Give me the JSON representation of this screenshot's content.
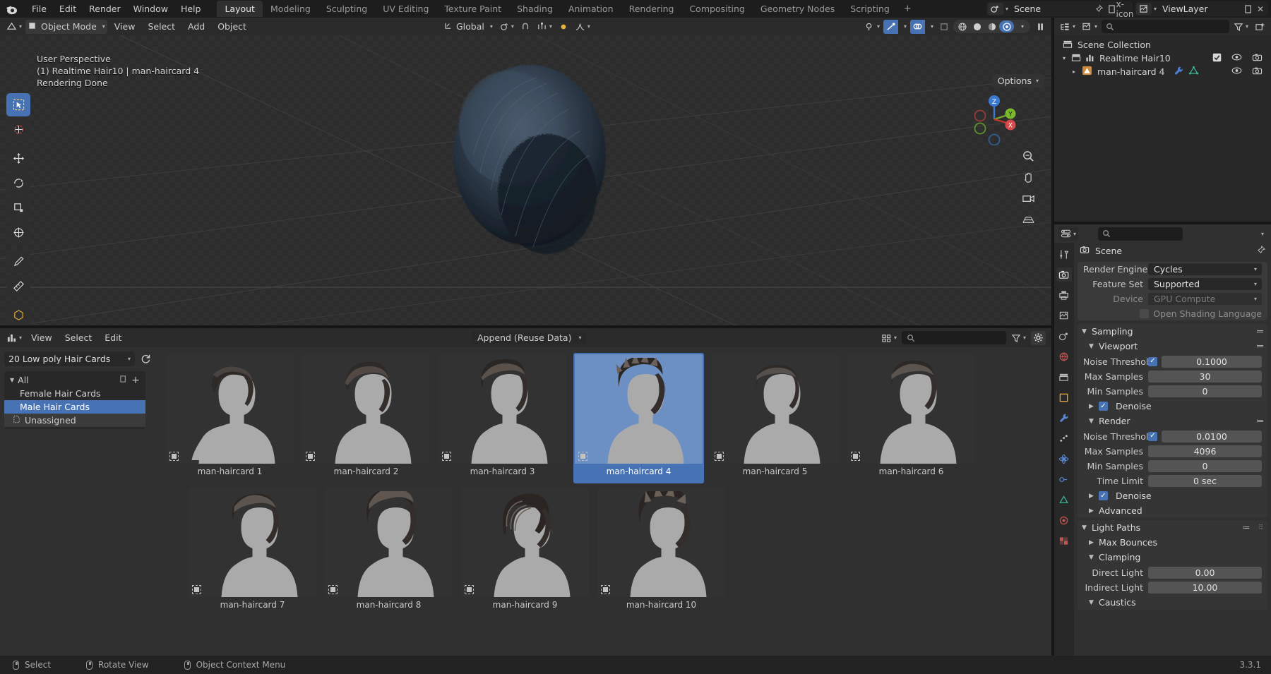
{
  "topbar": {
    "logo_icon": "blender-logo-icon",
    "menus": [
      "File",
      "Edit",
      "Render",
      "Window",
      "Help"
    ],
    "workspaces": [
      "Layout",
      "Modeling",
      "Sculpting",
      "UV Editing",
      "Texture Paint",
      "Shading",
      "Animation",
      "Rendering",
      "Compositing",
      "Geometry Nodes",
      "Scripting"
    ],
    "active_workspace": "Layout",
    "add_workspace_label": "+",
    "scene_name": "Scene",
    "viewlayer_name": "ViewLayer",
    "scene_icon": "scene-icon",
    "viewlayer_icon": "viewlayer-icon",
    "pin_icon": "pin-icon",
    "copy_icon": "new-copy-icon",
    "close_icon": "x-icon"
  },
  "viewport_header": {
    "editor_type_icon": "editor-type-icon",
    "mode": "Object Mode",
    "mode_icon": "object-mode-icon",
    "menus": [
      "View",
      "Select",
      "Add",
      "Object"
    ],
    "transform_orientation": "Global",
    "snap_icon": "magnet-icon",
    "proportional_icon": "proportional-edit-icon",
    "falloff_icon": "falloff-curve-icon",
    "visibility_icon": "visibility-icon",
    "gizmo_icon": "gizmo-icon",
    "overlays_icon": "overlays-icon",
    "xray_icon": "xray-icon",
    "shading_modes": [
      "wireframe",
      "solid",
      "material-preview",
      "rendered"
    ],
    "active_shading": "rendered",
    "pause_icon": "pause-render-icon"
  },
  "viewport": {
    "overlay_lines": [
      "User Perspective",
      "(1) Realtime Hair10 | man-haircard 4",
      "Rendering Done"
    ],
    "options_label": "Options",
    "gizmo_axes": [
      "Z",
      "Y",
      "X"
    ],
    "tools": [
      "select-box-tool",
      "cursor-tool",
      "move-tool",
      "rotate-tool",
      "scale-tool",
      "transform-tool",
      "annotate-tool",
      "measure-tool",
      "add-cube-tool"
    ],
    "active_tool": "select-box-tool",
    "nav_buttons": [
      "zoom-icon",
      "pan-hand-icon",
      "camera-view-icon",
      "ortho-persp-icon"
    ]
  },
  "outliner": {
    "display_mode_icon": "outliner-display-mode-icon",
    "filter_icon": "filter-icon",
    "new_collection_icon": "new-collection-icon",
    "search_placeholder": "",
    "rows": [
      {
        "label": "Scene Collection",
        "icon": "collection-icon",
        "indent": 0,
        "expander": "",
        "checkbox": false,
        "eye": false,
        "camera": false
      },
      {
        "label": "Realtime Hair10",
        "icon": "collection-icon",
        "indent": 1,
        "expander": "▾",
        "checkbox": true,
        "eye": true,
        "camera": true
      },
      {
        "label": "man-haircard 4",
        "icon": "mesh-object-icon",
        "indent": 2,
        "expander": "▸",
        "checkbox": false,
        "eye": true,
        "camera": true,
        "extra_icons": [
          "modifier-wrench-icon",
          "mesh-data-icon"
        ]
      }
    ]
  },
  "asset_browser": {
    "editor_type_icon": "asset-browser-icon",
    "menus": [
      "View",
      "Select",
      "Edit"
    ],
    "import_method": "Append (Reuse Data)",
    "library": "20 Low poly Hair Cards",
    "refresh_icon": "refresh-icon",
    "display_mode_icon": "thumbnail-grid-icon",
    "search_placeholder": "",
    "filter_icon": "filter-icon",
    "settings_icon": "gear-icon",
    "catalog_root": "All",
    "catalogs": [
      {
        "label": "Female Hair Cards",
        "selected": false,
        "unassigned": false
      },
      {
        "label": "Male Hair Cards",
        "selected": true,
        "unassigned": false
      },
      {
        "label": "Unassigned",
        "selected": false,
        "unassigned": true
      }
    ],
    "catalog_add_icon": "new-catalog-icon",
    "assets": [
      {
        "label": "man-haircard 1",
        "selected": false,
        "hair": "swept-right"
      },
      {
        "label": "man-haircard 2",
        "selected": false,
        "hair": "swept-left"
      },
      {
        "label": "man-haircard 3",
        "selected": false,
        "hair": "pompadour"
      },
      {
        "label": "man-haircard 4",
        "selected": true,
        "hair": "spiky"
      },
      {
        "label": "man-haircard 5",
        "selected": false,
        "hair": "short-flat"
      },
      {
        "label": "man-haircard 6",
        "selected": false,
        "hair": "side-part"
      },
      {
        "label": "man-haircard 7",
        "selected": false,
        "hair": "quiff"
      },
      {
        "label": "man-haircard 8",
        "selected": false,
        "hair": "tall-quiff"
      },
      {
        "label": "man-haircard 9",
        "selected": false,
        "hair": "long-fringe"
      },
      {
        "label": "man-haircard 10",
        "selected": false,
        "hair": "messy-tall"
      }
    ]
  },
  "properties": {
    "editor_type_icon": "properties-editor-icon",
    "search_placeholder": "",
    "breadcrumb": "Scene",
    "breadcrumb_icon": "render-properties-icon",
    "pin_icon": "pin-icon",
    "tabs": [
      "tool-icon",
      "render-properties-icon",
      "output-properties-icon",
      "view-layer-properties-icon",
      "scene-properties-icon",
      "world-properties-icon",
      "collection-properties-icon",
      "object-properties-icon",
      "modifier-properties-icon",
      "particles-properties-icon",
      "physics-properties-icon",
      "constraints-properties-icon",
      "data-properties-icon",
      "material-properties-icon",
      "texture-properties-icon"
    ],
    "active_tab_index": 1,
    "render_engine_label": "Render Engine",
    "render_engine_value": "Cycles",
    "feature_set_label": "Feature Set",
    "feature_set_value": "Supported",
    "device_label": "Device",
    "device_value": "GPU Compute",
    "osl_label": "Open Shading Language",
    "osl_checked": false,
    "panels": {
      "sampling": "Sampling",
      "viewport": "Viewport",
      "render": "Render",
      "advanced": "Advanced",
      "light_paths": "Light Paths",
      "max_bounces": "Max Bounces",
      "clamping": "Clamping",
      "caustics": "Caustics"
    },
    "viewport_sampling": {
      "noise_threshold_label": "Noise Threshold",
      "noise_threshold_checked": true,
      "noise_threshold_value": "0.1000",
      "max_samples_label": "Max Samples",
      "max_samples_value": "30",
      "min_samples_label": "Min Samples",
      "min_samples_value": "0",
      "denoise_label": "Denoise",
      "denoise_checked": true
    },
    "render_sampling": {
      "noise_threshold_label": "Noise Threshold",
      "noise_threshold_checked": true,
      "noise_threshold_value": "0.0100",
      "max_samples_label": "Max Samples",
      "max_samples_value": "4096",
      "min_samples_label": "Min Samples",
      "min_samples_value": "0",
      "time_limit_label": "Time Limit",
      "time_limit_value": "0 sec",
      "denoise_label": "Denoise",
      "denoise_checked": true
    },
    "clamping": {
      "direct_label": "Direct Light",
      "direct_value": "0.00",
      "indirect_label": "Indirect Light",
      "indirect_value": "10.00"
    }
  },
  "statusbar": {
    "items": [
      {
        "icon": "mouse-left-icon",
        "label": "Select"
      },
      {
        "icon": "mouse-middle-icon",
        "label": "Rotate View"
      },
      {
        "icon": "mouse-right-icon",
        "label": "Object Context Menu"
      }
    ],
    "version": "3.3.1"
  },
  "colors": {
    "accent_blue": "#4772b3",
    "panel_bg": "#303030",
    "editor_bg": "#282828",
    "header_bg": "#2b2b2b",
    "topbar_bg": "#1d1d1d"
  }
}
